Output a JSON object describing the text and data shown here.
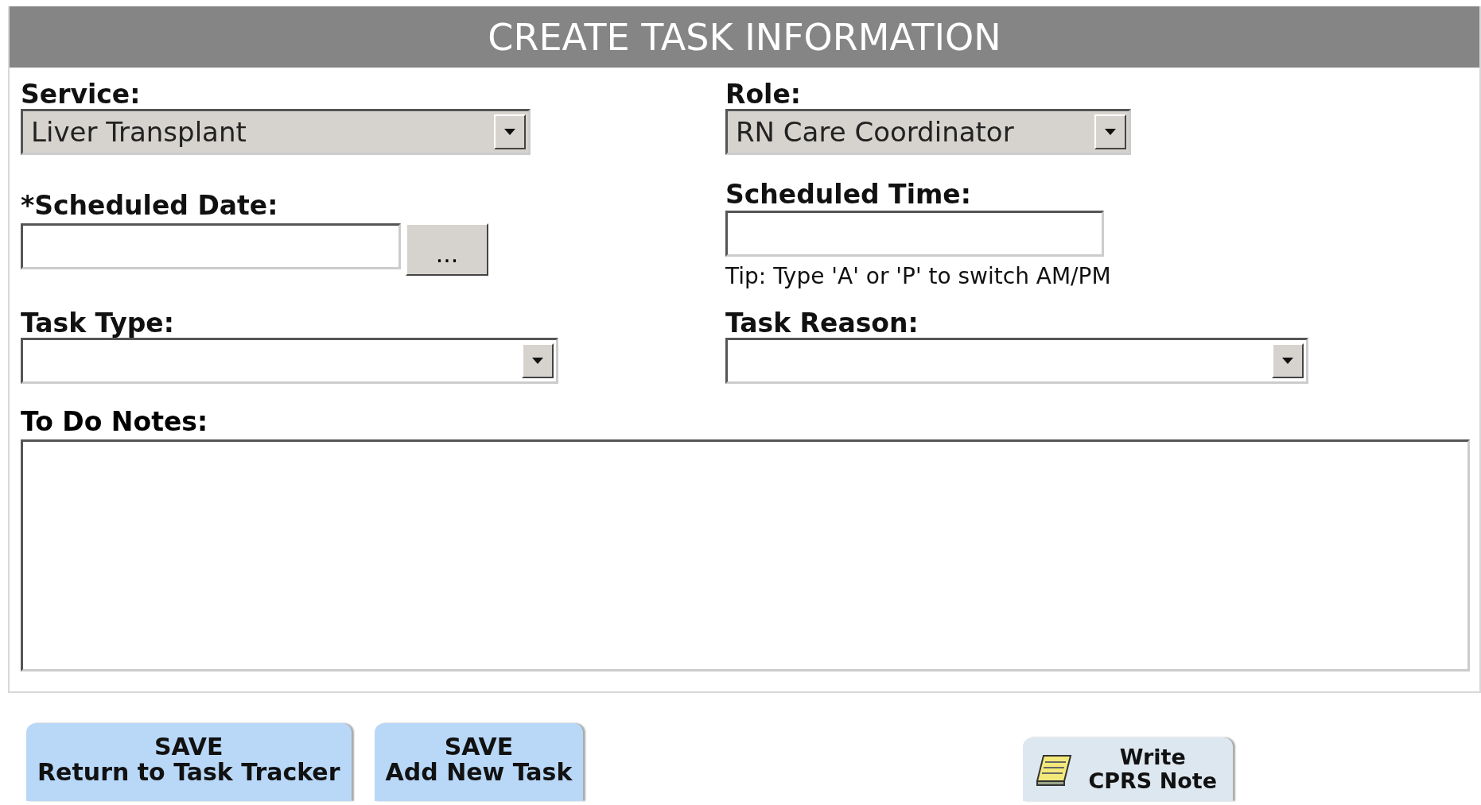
{
  "header": {
    "title": "CREATE TASK INFORMATION"
  },
  "fields": [
    {
      "kind": "select",
      "label": "Service:",
      "value": "Liver Transplant",
      "disabled": true
    },
    {
      "kind": "select",
      "label": "Role:",
      "value": "RN Care Coordinator",
      "disabled": true
    },
    {
      "kind": "date",
      "label": "*Scheduled Date:",
      "button": "..."
    },
    {
      "kind": "time",
      "label": "Scheduled Time:",
      "tip": "Tip: Type 'A' or 'P' to switch AM/PM"
    },
    {
      "kind": "select",
      "label": "Task Type:",
      "disabled": false
    },
    {
      "kind": "select",
      "label": "Task Reason:",
      "disabled": false
    }
  ],
  "notes": {
    "label": "To Do Notes:"
  },
  "buttons": [
    {
      "kind": "save",
      "lines": [
        "SAVE",
        "Return to Task Tracker"
      ]
    },
    {
      "kind": "save",
      "lines": [
        "SAVE",
        "Add New Task"
      ]
    },
    {
      "kind": "note",
      "lines": [
        "Write",
        "CPRS Note"
      ]
    }
  ]
}
